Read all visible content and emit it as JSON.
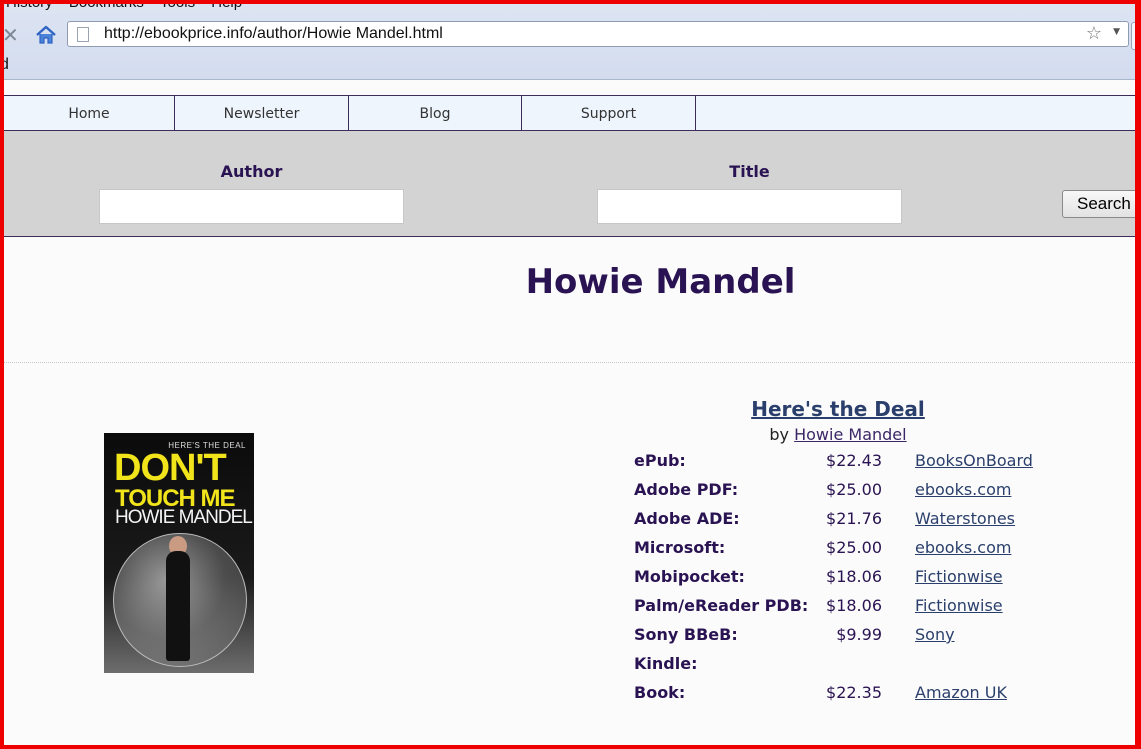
{
  "browser": {
    "menu_items": [
      "History",
      "Bookmarks",
      "Tools",
      "Help"
    ],
    "url": "http://ebookprice.info/author/Howie Mandel.html",
    "bookmarks_fragment": "d"
  },
  "site_nav": {
    "items": [
      {
        "label": "Home"
      },
      {
        "label": "Newsletter"
      },
      {
        "label": "Blog"
      },
      {
        "label": "Support"
      }
    ]
  },
  "search": {
    "author_label": "Author",
    "author_value": "",
    "title_label": "Title",
    "title_value": "",
    "button_label": "Search"
  },
  "author_heading": "Howie Mandel",
  "book": {
    "cover": {
      "top_text": "HERE'S THE DEAL",
      "line1": "DON'T",
      "line2": "TOUCH ME",
      "line3": "HOWIE MANDEL"
    },
    "title": "Here's the Deal",
    "by_prefix": "by",
    "author_link": "Howie Mandel",
    "prices": [
      {
        "format": "ePub:",
        "price": "$22.43",
        "store": "BooksOnBoard"
      },
      {
        "format": "Adobe PDF:",
        "price": "$25.00",
        "store": "ebooks.com"
      },
      {
        "format": "Adobe ADE:",
        "price": "$21.76",
        "store": "Waterstones"
      },
      {
        "format": "Microsoft:",
        "price": "$25.00",
        "store": "ebooks.com"
      },
      {
        "format": "Mobipocket:",
        "price": "$18.06",
        "store": "Fictionwise"
      },
      {
        "format": "Palm/eReader PDB:",
        "price": "$18.06",
        "store": "Fictionwise"
      },
      {
        "format": "Sony BBeB:",
        "price": "$9.99",
        "store": "Sony"
      },
      {
        "format": "Kindle:",
        "price": "",
        "store": ""
      },
      {
        "format": "Book:",
        "price": "$22.35",
        "store": "Amazon UK"
      }
    ]
  },
  "colors": {
    "frame": "#ee0000",
    "heading": "#2a1352",
    "link": "#2a3f6b",
    "search_band": "#d3d3d3",
    "nav_bg": "#eef5fd"
  }
}
